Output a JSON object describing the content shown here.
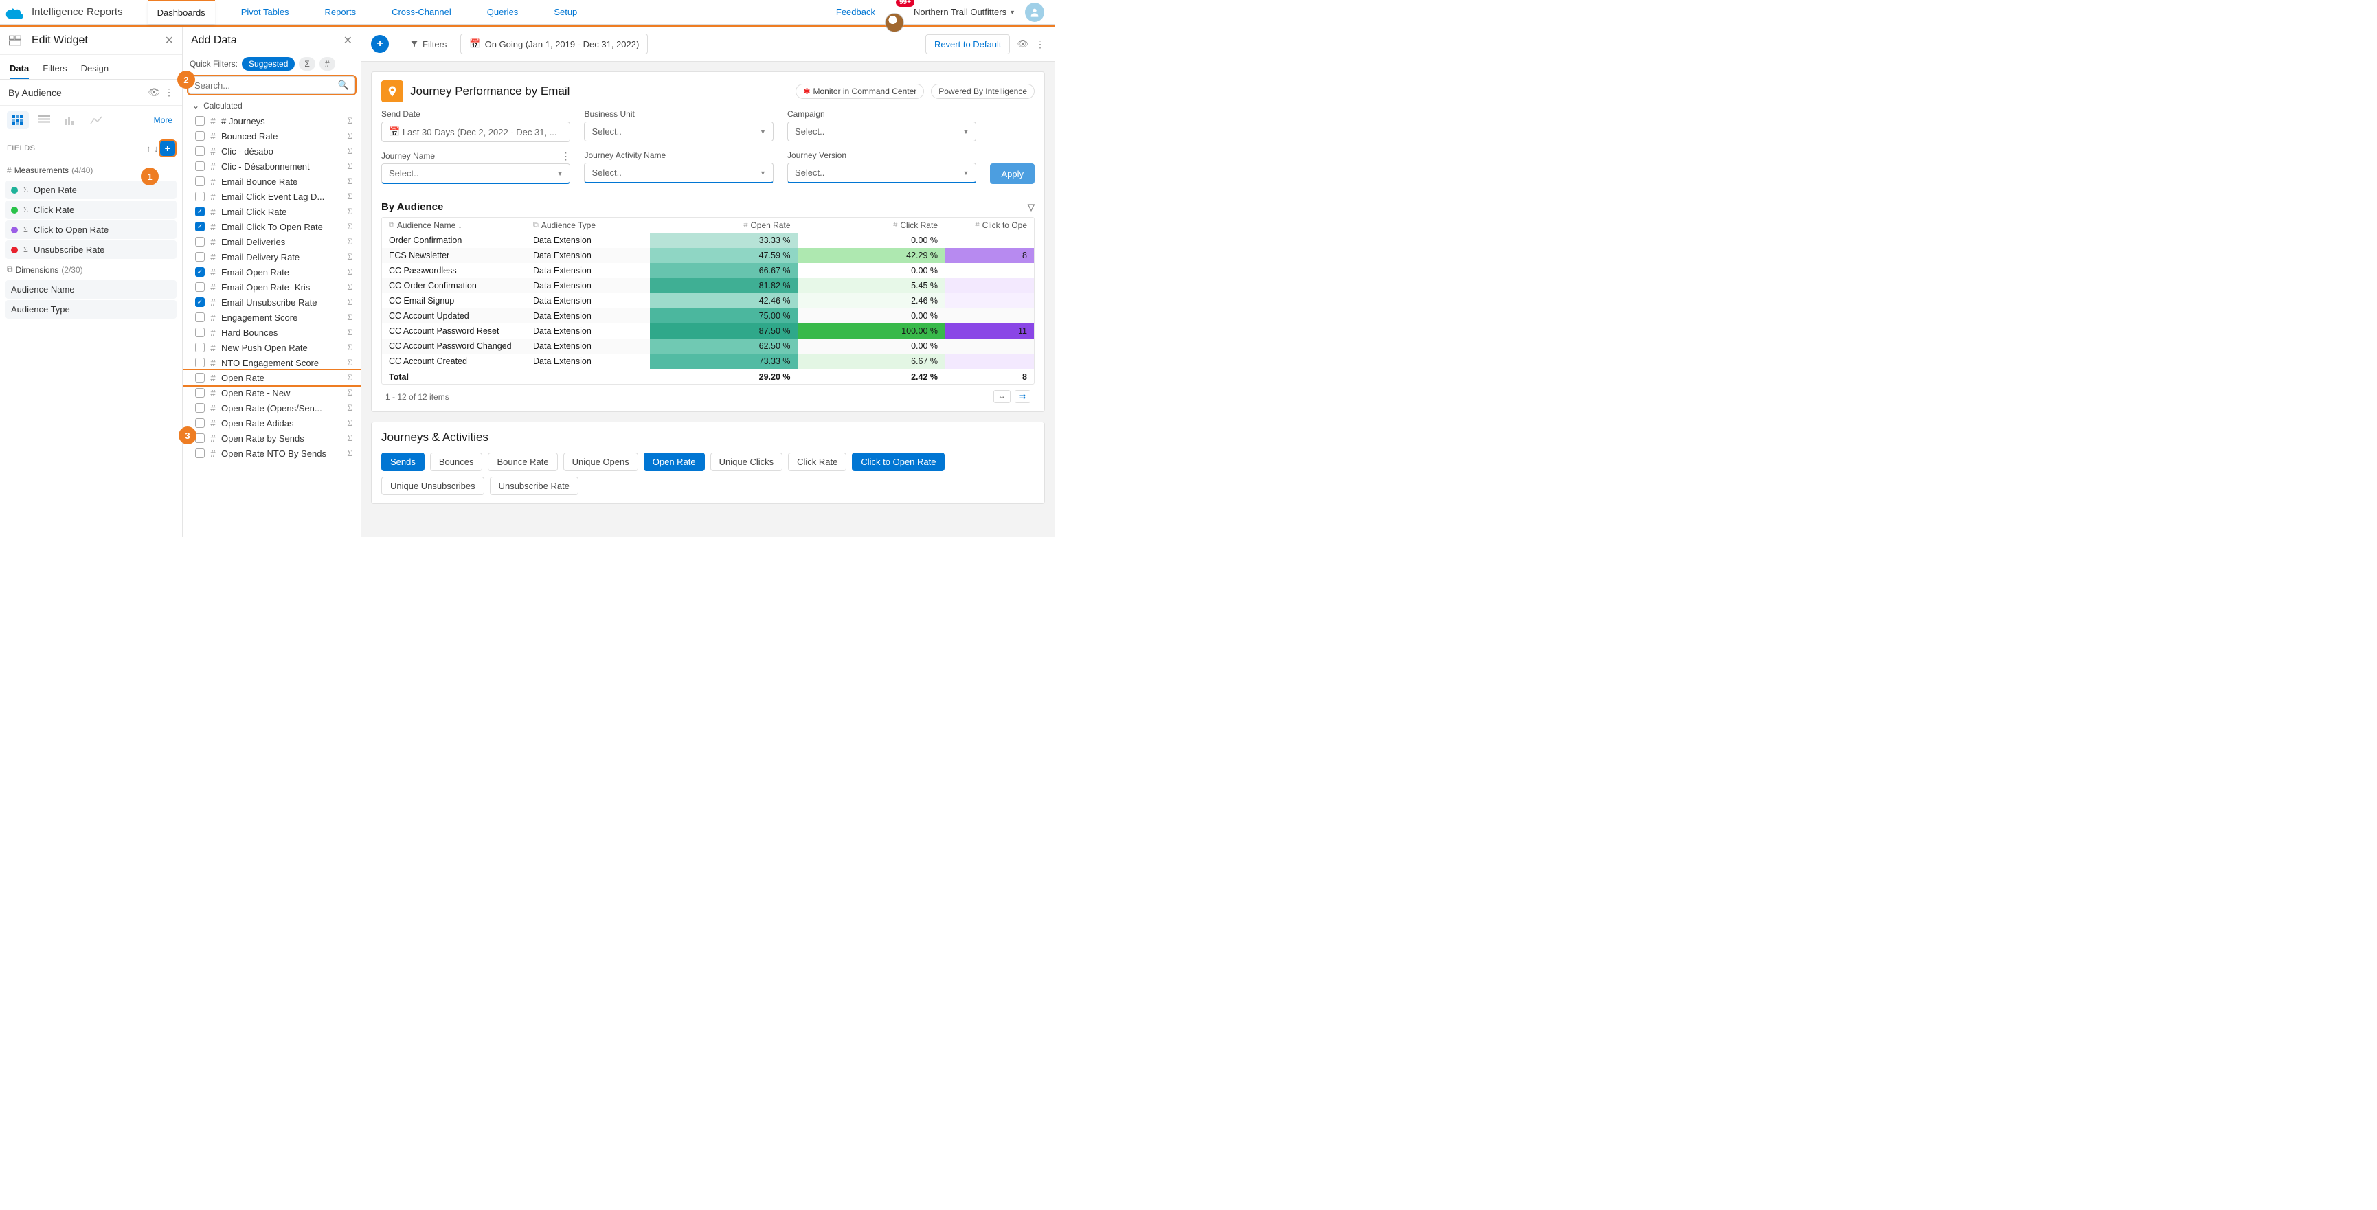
{
  "top": {
    "title": "Intelligence Reports",
    "tabs": [
      "Dashboards",
      "Pivot Tables",
      "Reports",
      "Cross-Channel",
      "Queries",
      "Setup"
    ],
    "active_tab": "Dashboards",
    "feedback": "Feedback",
    "notif_count": "99+",
    "org": "Northern Trail Outfitters"
  },
  "toolbar": {
    "filters_label": "Filters",
    "date_range": "On Going (Jan 1, 2019 - Dec 31, 2022)",
    "revert": "Revert to Default"
  },
  "left": {
    "title": "Edit Widget",
    "subtabs": [
      "Data",
      "Filters",
      "Design"
    ],
    "active_subtab": "Data",
    "by_line": "By Audience",
    "viz_more": "More",
    "fields_label": "FIELDS",
    "measurements": {
      "label": "Measurements",
      "meta": "(4/40)"
    },
    "measure_items": [
      {
        "label": "Open Rate",
        "dot": "#1fb299"
      },
      {
        "label": "Click Rate",
        "dot": "#29c24a"
      },
      {
        "label": "Click to Open Rate",
        "dot": "#9b5ee6"
      },
      {
        "label": "Unsubscribe Rate",
        "dot": "#e8222e"
      }
    ],
    "dimensions": {
      "label": "Dimensions",
      "meta": "(2/30)"
    },
    "dim_items": [
      {
        "label": "Audience Name"
      },
      {
        "label": "Audience Type"
      }
    ]
  },
  "mid": {
    "title": "Add Data",
    "quick_filters_label": "Quick Filters:",
    "suggested": "Suggested",
    "search_placeholder": "Search...",
    "group": "Calculated",
    "fields": [
      {
        "label": "# Journeys",
        "checked": false
      },
      {
        "label": "Bounced Rate",
        "checked": false
      },
      {
        "label": "Clic - désabo",
        "checked": false
      },
      {
        "label": "Clic - Désabonnement",
        "checked": false
      },
      {
        "label": "Email Bounce Rate",
        "checked": false
      },
      {
        "label": "Email Click Event Lag D...",
        "checked": false
      },
      {
        "label": "Email Click Rate",
        "checked": true
      },
      {
        "label": "Email Click To Open Rate",
        "checked": true
      },
      {
        "label": "Email Deliveries",
        "checked": false
      },
      {
        "label": "Email Delivery Rate",
        "checked": false
      },
      {
        "label": "Email Open Rate",
        "checked": true
      },
      {
        "label": "Email Open Rate- Kris",
        "checked": false
      },
      {
        "label": "Email Unsubscribe Rate",
        "checked": true
      },
      {
        "label": "Engagement Score",
        "checked": false
      },
      {
        "label": "Hard Bounces",
        "checked": false
      },
      {
        "label": "New Push Open Rate",
        "checked": false
      },
      {
        "label": "NTO Engagement Score",
        "checked": false
      },
      {
        "label": "Open Rate",
        "checked": false,
        "highlight": true
      },
      {
        "label": "Open Rate - New",
        "checked": false
      },
      {
        "label": "Open Rate (Opens/Sen...",
        "checked": false
      },
      {
        "label": "Open Rate Adidas",
        "checked": false
      },
      {
        "label": "Open Rate by Sends",
        "checked": false
      },
      {
        "label": "Open Rate NTO By Sends",
        "checked": false
      }
    ]
  },
  "card": {
    "title": "Journey Performance by Email",
    "chip1": "Monitor in Command Center",
    "chip2": "Powered By Intelligence",
    "send_date": {
      "label": "Send Date",
      "value": "Last 30 Days (Dec 2, 2022 - Dec 31, ..."
    },
    "bu": {
      "label": "Business Unit",
      "placeholder": "Select.."
    },
    "campaign": {
      "label": "Campaign",
      "placeholder": "Select.."
    },
    "jname": {
      "label": "Journey Name",
      "placeholder": "Select.."
    },
    "jact": {
      "label": "Journey Activity Name",
      "placeholder": "Select.."
    },
    "jver": {
      "label": "Journey Version",
      "placeholder": "Select.."
    },
    "apply": "Apply"
  },
  "table": {
    "title": "By Audience",
    "cols": [
      "Audience Name",
      "Audience Type",
      "Open Rate",
      "Click Rate",
      "Click to Ope"
    ],
    "rows": [
      {
        "name": "Order Confirmation",
        "type": "Data Extension",
        "open": "33.33 %",
        "open_bg": "#b7e3d7",
        "click": "0.00 %",
        "click_bg": "",
        "cto": "",
        "cto_bg": ""
      },
      {
        "name": "ECS Newsletter",
        "type": "Data Extension",
        "open": "47.59 %",
        "open_bg": "#8fd6c4",
        "click": "42.29 %",
        "click_bg": "#aee8b0",
        "cto": "8",
        "cto_bg": "#b78af0"
      },
      {
        "name": "CC Passwordless",
        "type": "Data Extension",
        "open": "66.67 %",
        "open_bg": "#67c4ae",
        "click": "0.00 %",
        "click_bg": "",
        "cto": "",
        "cto_bg": ""
      },
      {
        "name": "CC Order Confirmation",
        "type": "Data Extension",
        "open": "81.82 %",
        "open_bg": "#3faf94",
        "click": "5.45 %",
        "click_bg": "#e7f8e8",
        "cto": "",
        "cto_bg": "#f3e9fe"
      },
      {
        "name": "CC Email Signup",
        "type": "Data Extension",
        "open": "42.46 %",
        "open_bg": "#9ddbcb",
        "click": "2.46 %",
        "click_bg": "#f2fbf3",
        "cto": "",
        "cto_bg": "#f7f0ff"
      },
      {
        "name": "CC Account Updated",
        "type": "Data Extension",
        "open": "75.00 %",
        "open_bg": "#4bb79e",
        "click": "0.00 %",
        "click_bg": "",
        "cto": "",
        "cto_bg": ""
      },
      {
        "name": "CC Account Password Reset",
        "type": "Data Extension",
        "open": "87.50 %",
        "open_bg": "#2fa88a",
        "click": "100.00 %",
        "click_bg": "#38b94a",
        "cto": "11",
        "cto_bg": "#8a46e6"
      },
      {
        "name": "CC Account Password Changed",
        "type": "Data Extension",
        "open": "62.50 %",
        "open_bg": "#70c9b3",
        "click": "0.00 %",
        "click_bg": "",
        "cto": "",
        "cto_bg": ""
      },
      {
        "name": "CC Account Created",
        "type": "Data Extension",
        "open": "73.33 %",
        "open_bg": "#52bba3",
        "click": "6.67 %",
        "click_bg": "#e3f6e4",
        "cto": "",
        "cto_bg": "#f3e9fe"
      }
    ],
    "total": {
      "label": "Total",
      "open": "29.20 %",
      "click": "2.42 %",
      "cto": "8"
    },
    "pager": "1 - 12 of 12 items"
  },
  "journeys": {
    "title": "Journeys & Activities",
    "pills": [
      {
        "label": "Sends",
        "active": true
      },
      {
        "label": "Bounces",
        "active": false
      },
      {
        "label": "Bounce Rate",
        "active": false
      },
      {
        "label": "Unique Opens",
        "active": false
      },
      {
        "label": "Open Rate",
        "active": true
      },
      {
        "label": "Unique Clicks",
        "active": false
      },
      {
        "label": "Click Rate",
        "active": false
      },
      {
        "label": "Click to Open Rate",
        "active": true
      },
      {
        "label": "Unique Unsubscribes",
        "active": false
      },
      {
        "label": "Unsubscribe Rate",
        "active": false
      }
    ]
  },
  "callouts": {
    "1": "1",
    "2": "2",
    "3": "3"
  }
}
